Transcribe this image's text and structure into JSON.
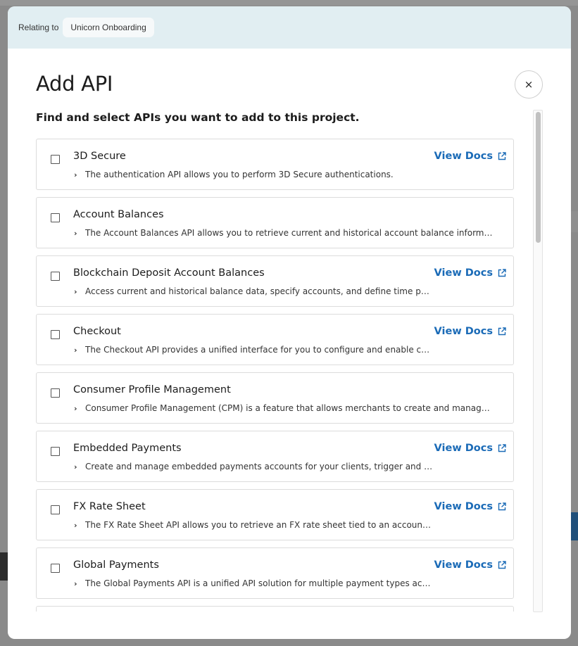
{
  "relating": {
    "label": "Relating to",
    "project": "Unicorn Onboarding"
  },
  "modal": {
    "title": "Add API",
    "close_glyph": "×",
    "subtitle": "Find and select APIs you want to add to this project."
  },
  "view_docs_label": "View Docs",
  "apis": [
    {
      "name": "3D Secure",
      "description": "The authentication API allows you to perform 3D Secure authentications.",
      "has_docs": true
    },
    {
      "name": "Account Balances",
      "description": "The Account Balances API allows you to retrieve current and historical account balance information.",
      "has_docs": false
    },
    {
      "name": "Blockchain Deposit Account Balances",
      "description": "Access current and historical balance data, specify accounts, and define time periods fo...",
      "has_docs": true
    },
    {
      "name": "Checkout",
      "description": "The Checkout API provides a unified interface for you to configure and enable checkout ...",
      "has_docs": true
    },
    {
      "name": "Consumer Profile Management",
      "description": "Consumer Profile Management (CPM) is a feature that allows merchants to create and manage PCI co...",
      "has_docs": false
    },
    {
      "name": "Embedded Payments",
      "description": "Create and manage embedded payments accounts for your clients, trigger and track tra...",
      "has_docs": true
    },
    {
      "name": "FX Rate Sheet",
      "description": "The FX Rate Sheet API allows you to retrieve an FX rate sheet tied to an account in real-...",
      "has_docs": true
    },
    {
      "name": "Global Payments",
      "description": "The Global Payments API is a unified API solution for multiple payment types across glo...",
      "has_docs": true
    }
  ],
  "icons": {
    "checkbox": "checkbox-icon",
    "chevron": "chevron-right-icon",
    "external_link": "external-link-icon",
    "close": "close-icon"
  },
  "colors": {
    "link": "#1b6bb7",
    "header_bar": "#e1eef2",
    "overlay": "#7d7d7d"
  }
}
